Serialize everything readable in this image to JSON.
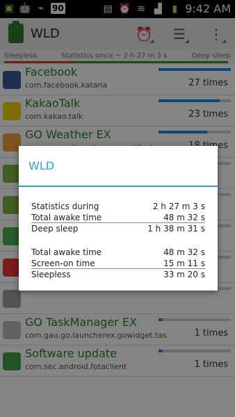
{
  "statusbar": {
    "badge": "90",
    "time": "9:42 AM",
    "icons": [
      "notification-icon",
      "android-icon",
      "usb-icon",
      "vibrate-icon",
      "alarm-icon",
      "wifi-icon",
      "signal-icon",
      "battery-icon"
    ]
  },
  "appbar": {
    "title": "WLD",
    "actions": [
      "alarm-clock-icon",
      "sort-icon",
      "overflow-menu-icon"
    ]
  },
  "stats_header": {
    "left": "Sleepless",
    "center": "Statistics since ~ 2 h 27 m 3 s",
    "right": "Deep sleep"
  },
  "apps": [
    {
      "name": "Facebook",
      "package": "com.facebook.katana",
      "times": "27 times",
      "bar_fraction": 1.0,
      "icon": "facebook-icon",
      "color": "#3b5998"
    },
    {
      "name": "KakaoTalk",
      "package": "com.kakao.talk",
      "times": "23 times",
      "bar_fraction": 0.85,
      "icon": "kakaotalk-icon",
      "color": "#f4d200"
    },
    {
      "name": "GO Weather EX",
      "package": "com.gau.go.launcherex.gowidget.we",
      "times": "18 times",
      "bar_fraction": 0.67,
      "icon": "weather-icon",
      "color": "#f2a33a"
    },
    {
      "name": "",
      "package": "",
      "times": "",
      "bar_fraction": 0.0,
      "icon": "android-app-icon",
      "color": "#7cb342"
    },
    {
      "name": "",
      "package": "",
      "times": "",
      "bar_fraction": 0.0,
      "icon": "android-app-icon",
      "color": "#7cb342"
    },
    {
      "name": "",
      "package": "",
      "times": "",
      "bar_fraction": 0.0,
      "icon": "maps-icon",
      "color": "#4caf50"
    },
    {
      "name": "",
      "package": "",
      "times": "",
      "bar_fraction": 0.0,
      "icon": "calendar-icon",
      "color": "#e53935"
    },
    {
      "name": "",
      "package": "",
      "times": "",
      "bar_fraction": 0.0,
      "icon": "clock-icon",
      "color": "#9e9e9e"
    },
    {
      "name": "GO TaskManager EX",
      "package": "com.gau.go.launcherex.gowidget.tas",
      "times": "1 times",
      "bar_fraction": 0.06,
      "icon": "taskmanager-icon",
      "color": "#bdbdbd"
    },
    {
      "name": "Software update",
      "package": "com.sec.android.fotaclient",
      "times": "1 times",
      "bar_fraction": 0.06,
      "icon": "software-update-icon",
      "color": "#43a047"
    }
  ],
  "dialog": {
    "title": "WLD",
    "rows": [
      {
        "label": "Statistics during",
        "value": "2 h 27 m 3 s"
      },
      {
        "label": "Total awake time",
        "value": "48 m 32 s"
      },
      {
        "label": "Deep sleep",
        "value": "1 h 38 m 31 s"
      },
      {
        "label": "Total awake time",
        "value": "48 m 32 s"
      },
      {
        "label": "Screen-on time",
        "value": "15 m 11 s"
      },
      {
        "label": "Sleepless",
        "value": "33 m 20 s"
      }
    ]
  }
}
